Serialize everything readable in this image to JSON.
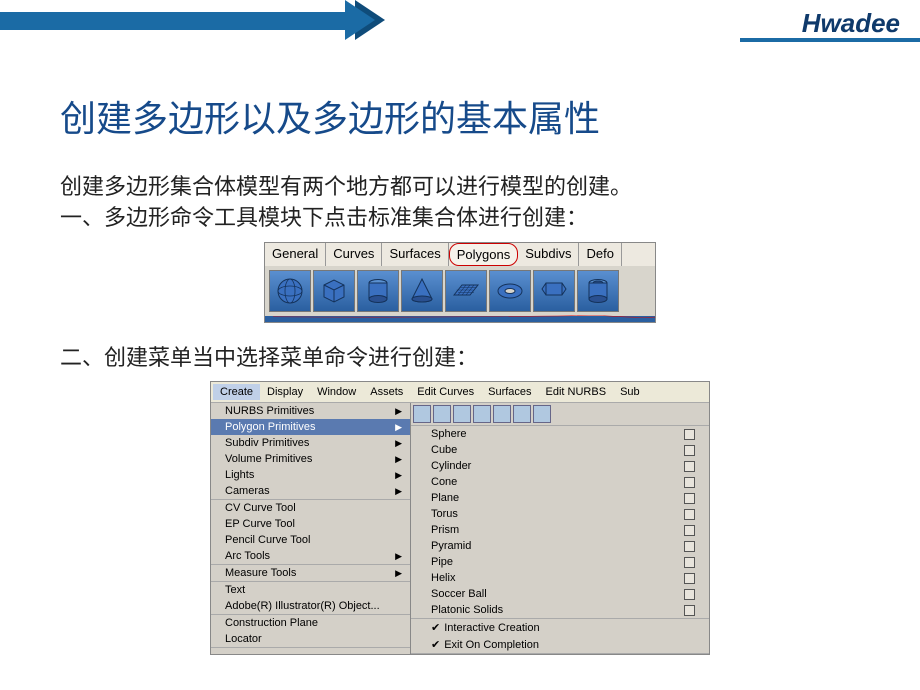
{
  "brand": "Hwadee",
  "title": "创建多边形以及多边形的基本属性",
  "intro": "创建多边形集合体模型有两个地方都可以进行模型的创建。",
  "section1": "一、多边形命令工具模块下点击标准集合体进行创建：",
  "section2": "二、创建菜单当中选择菜单命令进行创建：",
  "tabs": {
    "general": "General",
    "curves": "Curves",
    "surfaces": "Surfaces",
    "polygons": "Polygons",
    "subdivs": "Subdivs",
    "defo": "Defo"
  },
  "shelf_icons": [
    "sphere",
    "cube",
    "cylinder",
    "cone",
    "plane",
    "torus",
    "prism",
    "pipe"
  ],
  "menubar": {
    "create": "Create",
    "display": "Display",
    "window": "Window",
    "assets": "Assets",
    "edit_curves": "Edit Curves",
    "surfaces": "Surfaces",
    "edit_nurbs": "Edit NURBS",
    "sub": "Sub"
  },
  "menu_left": {
    "nurbs": "NURBS Primitives",
    "polygon": "Polygon Primitives",
    "subdiv": "Subdiv Primitives",
    "volume": "Volume Primitives",
    "lights": "Lights",
    "cameras": "Cameras",
    "cv_curve": "CV Curve Tool",
    "ep_curve": "EP Curve Tool",
    "pencil_curve": "Pencil Curve Tool",
    "arc_tools": "Arc Tools",
    "measure": "Measure Tools",
    "text": "Text",
    "adobe": "Adobe(R) Illustrator(R) Object...",
    "construction": "Construction Plane",
    "locator": "Locator"
  },
  "submenu": {
    "sphere": "Sphere",
    "cube": "Cube",
    "cylinder": "Cylinder",
    "cone": "Cone",
    "plane": "Plane",
    "torus": "Torus",
    "prism": "Prism",
    "pyramid": "Pyramid",
    "pipe": "Pipe",
    "helix": "Helix",
    "soccer": "Soccer Ball",
    "platonic": "Platonic Solids",
    "interactive": "Interactive Creation",
    "exit": "Exit On Completion"
  }
}
